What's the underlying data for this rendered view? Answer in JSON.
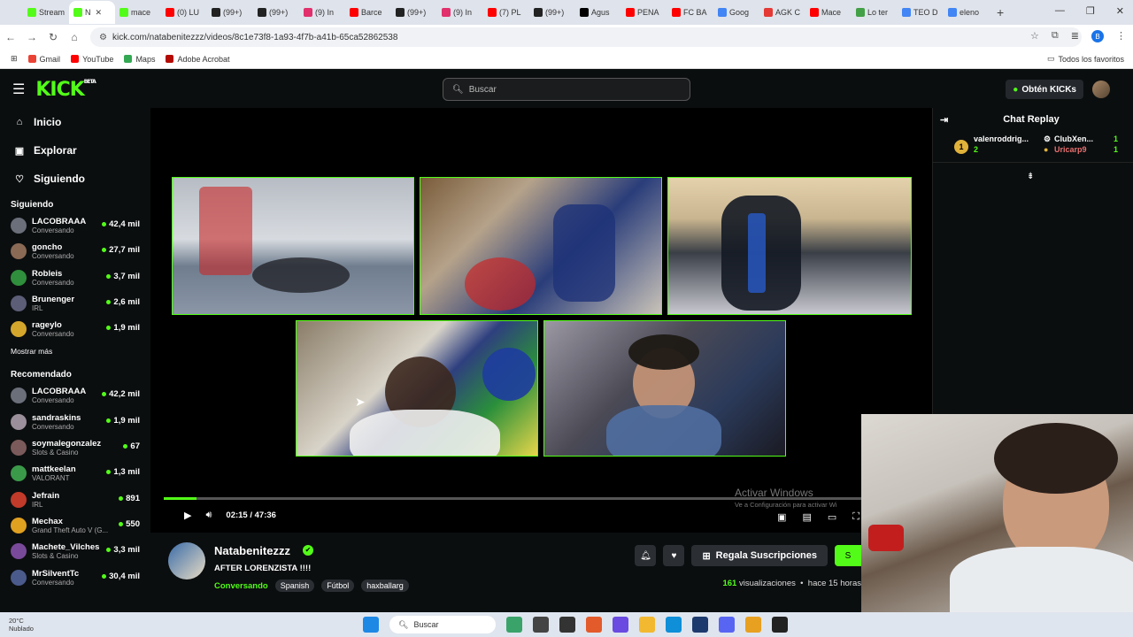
{
  "browser": {
    "tabs": [
      {
        "label": "Stream",
        "color": "#53fc18"
      },
      {
        "label": "N",
        "color": "#53fc18",
        "active": true
      },
      {
        "label": "mace",
        "color": "#53fc18"
      },
      {
        "label": "(0) LU",
        "color": "#ff0000"
      },
      {
        "label": "(99+)",
        "color": "#222222"
      },
      {
        "label": "(99+)",
        "color": "#222222"
      },
      {
        "label": "(9) In",
        "color": "#e1306c"
      },
      {
        "label": "Barce",
        "color": "#ff0000"
      },
      {
        "label": "(99+)",
        "color": "#222222"
      },
      {
        "label": "(9) In",
        "color": "#e1306c"
      },
      {
        "label": "(7) PL",
        "color": "#ff0000"
      },
      {
        "label": "(99+)",
        "color": "#222222"
      },
      {
        "label": "Agus",
        "color": "#000000"
      },
      {
        "label": "PENA",
        "color": "#ff0000"
      },
      {
        "label": "FC BA",
        "color": "#ff0000"
      },
      {
        "label": "Goog",
        "color": "#4285f4"
      },
      {
        "label": "AGK C",
        "color": "#e53935"
      },
      {
        "label": "Mace",
        "color": "#ff0000"
      },
      {
        "label": "Lo ter",
        "color": "#43a047"
      },
      {
        "label": "TEO D",
        "color": "#4285f4"
      },
      {
        "label": "eleno",
        "color": "#4285f4"
      }
    ],
    "new_tab": "+",
    "url": "kick.com/natabenitezzz/videos/8c1e73f8-1a93-4f7b-a41b-65ca52862538",
    "profile_initial": "B",
    "bookmarks": [
      {
        "label": "Gmail",
        "color": "#ea4335"
      },
      {
        "label": "YouTube",
        "color": "#ff0000"
      },
      {
        "label": "Maps",
        "color": "#34a853"
      },
      {
        "label": "Adobe Acrobat",
        "color": "#b30b00"
      }
    ],
    "all_bookmarks": "Todos los favoritos"
  },
  "header": {
    "logo": "KICK",
    "logo_badge": "BETA",
    "search_placeholder": "Buscar",
    "get_kicks": "Obtén KICKs"
  },
  "sidebar": {
    "nav": [
      {
        "label": "Inicio",
        "icon": "home-icon"
      },
      {
        "label": "Explorar",
        "icon": "browse-icon"
      },
      {
        "label": "Siguiendo",
        "icon": "heart-icon"
      }
    ],
    "following_title": "Siguiendo",
    "following": [
      {
        "name": "LACOBRAAA",
        "category": "Conversando",
        "viewers": "42,4 mil",
        "color": "#6a6f7a"
      },
      {
        "name": "goncho",
        "category": "Conversando",
        "viewers": "27,7 mil",
        "color": "#8a6a55"
      },
      {
        "name": "Robleis",
        "category": "Conversando",
        "viewers": "3,7 mil",
        "color": "#2f8f3c"
      },
      {
        "name": "Brunenger",
        "category": "IRL",
        "viewers": "2,6 mil",
        "color": "#5c5e78"
      },
      {
        "name": "rageylo",
        "category": "Conversando",
        "viewers": "1,9 mil",
        "color": "#d4a72c"
      }
    ],
    "show_more": "Mostrar más",
    "recommended_title": "Recomendado",
    "recommended": [
      {
        "name": "LACOBRAAA",
        "category": "Conversando",
        "viewers": "42,2 mil",
        "color": "#6a6f7a"
      },
      {
        "name": "sandraskins",
        "category": "Conversando",
        "viewers": "1,9 mil",
        "color": "#9a8f9a"
      },
      {
        "name": "soymalegonzalez",
        "category": "Slots & Casino",
        "viewers": "67",
        "color": "#7a5a5a"
      },
      {
        "name": "mattkeelan",
        "category": "VALORANT",
        "viewers": "1,3 mil",
        "color": "#3a9a4a"
      },
      {
        "name": "Jefrain",
        "category": "IRL",
        "viewers": "891",
        "color": "#c23a2a"
      },
      {
        "name": "Mechax",
        "category": "Grand Theft Auto V (G...",
        "viewers": "550",
        "color": "#e0a020"
      },
      {
        "name": "Machete_Vilches",
        "category": "Slots & Casino",
        "viewers": "3,3 mil",
        "color": "#7a4a9a"
      },
      {
        "name": "MrSilventTc",
        "category": "Conversando",
        "viewers": "30,4 mil",
        "color": "#4a5a8a"
      }
    ]
  },
  "player": {
    "current_time": "02:15",
    "duration": "47:36",
    "progress": 0.047,
    "watermark_title": "Activar Windows",
    "watermark_sub": "Ve a Configuración para activar Wi"
  },
  "stream": {
    "streamer": "Natabenitezzz",
    "title": "AFTER LORENZISTA !!!!",
    "category": "Conversando",
    "tags": [
      "Spanish",
      "Fútbol",
      "haxballarg"
    ],
    "subscribe_label": "Regala Suscripciones",
    "follow_label": "S",
    "views_count": "161",
    "views_label": "visualizaciones",
    "age": "hace 15 horas"
  },
  "chat": {
    "title": "Chat Replay",
    "gifter_rank": "1",
    "gifters": [
      {
        "name": "valenroddrig...",
        "count": "2"
      },
      {
        "name": "ClubXen...",
        "count": "1"
      },
      {
        "name": "Uricarp9",
        "count": "1"
      }
    ]
  },
  "taskbar": {
    "temperature": "20°C",
    "weather": "Nublado",
    "search": "Buscar"
  }
}
